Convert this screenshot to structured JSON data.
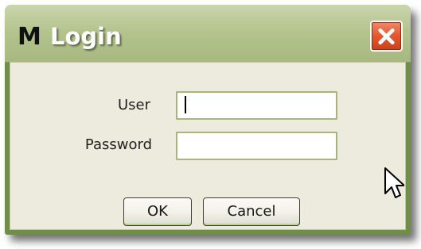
{
  "window": {
    "logo_letter": "M",
    "title": "Login",
    "close_icon": "close-icon"
  },
  "form": {
    "user_label": "User",
    "user_value": "",
    "password_label": "Password",
    "password_value": ""
  },
  "buttons": {
    "ok_label": "OK",
    "cancel_label": "Cancel"
  },
  "colors": {
    "title_bar": "#b5c48f",
    "client_background": "#ecebdd",
    "input_border": "#a7b67b",
    "close_button": "#e65a32"
  },
  "pointer": {
    "icon": "arrow-cursor-icon"
  }
}
